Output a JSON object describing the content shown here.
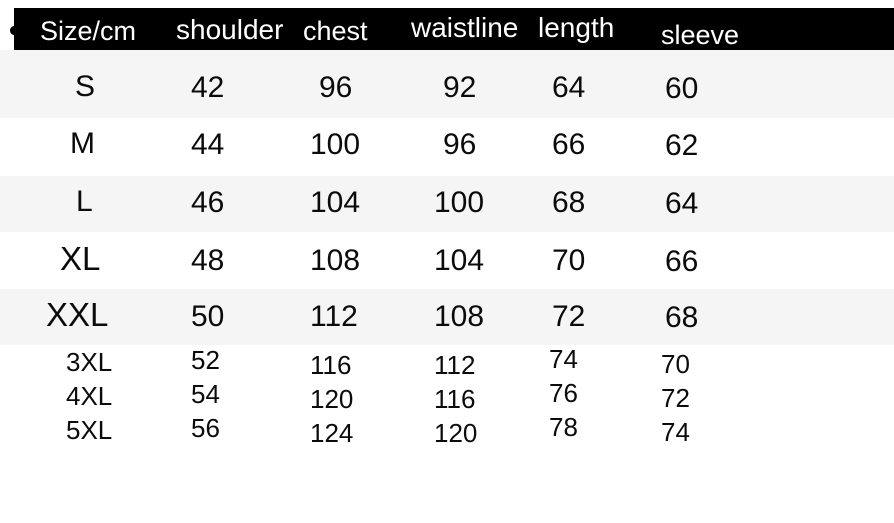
{
  "chart_data": {
    "type": "table",
    "title": "Size/cm",
    "columns": [
      "Size/cm",
      "shoulder",
      "chest",
      "waistline",
      "length",
      "sleeve"
    ],
    "rows": [
      {
        "size": "S",
        "shoulder": "42",
        "chest": "96",
        "waistline": "92",
        "length": "64",
        "sleeve": "60"
      },
      {
        "size": "M",
        "shoulder": "44",
        "chest": "100",
        "waistline": "96",
        "length": "66",
        "sleeve": "62"
      },
      {
        "size": "L",
        "shoulder": "46",
        "chest": "104",
        "waistline": "100",
        "length": "68",
        "sleeve": "64"
      },
      {
        "size": "XL",
        "shoulder": "48",
        "chest": "108",
        "waistline": "104",
        "length": "70",
        "sleeve": "66"
      },
      {
        "size": "XXL",
        "shoulder": "50",
        "chest": "112",
        "waistline": "108",
        "length": "72",
        "sleeve": "68"
      },
      {
        "size": "3XL",
        "shoulder": "52",
        "chest": "116",
        "waistline": "112",
        "length": "74",
        "sleeve": "70"
      },
      {
        "size": "4XL",
        "shoulder": "54",
        "chest": "120",
        "waistline": "116",
        "length": "76",
        "sleeve": "72"
      },
      {
        "size": "5XL",
        "shoulder": "56",
        "chest": "124",
        "waistline": "120",
        "length": "78",
        "sleeve": "74"
      }
    ],
    "xlabel": "",
    "ylabel": "",
    "legend": "none",
    "grid": false
  },
  "header": {
    "col_size": "Size/cm",
    "col_shoulder": "shoulder",
    "col_chest": "chest",
    "col_waistline": "waistline",
    "col_length": "length",
    "col_sleeve": "sleeve",
    "background_color": "#000000",
    "text_color": "#ffffff"
  },
  "colors": {
    "stripe": "#f5f5f5",
    "page": "#ffffff",
    "text": "#0b0b0b"
  },
  "rows": {
    "r0": {
      "size": "S",
      "shoulder": "42",
      "chest": "96",
      "waistline": "92",
      "length": "64",
      "sleeve": "60"
    },
    "r1": {
      "size": "M",
      "shoulder": "44",
      "chest": "100",
      "waistline": "96",
      "length": "66",
      "sleeve": "62"
    },
    "r2": {
      "size": "L",
      "shoulder": "46",
      "chest": "104",
      "waistline": "100",
      "length": "68",
      "sleeve": "64"
    },
    "r3": {
      "size": "XL",
      "shoulder": "48",
      "chest": "108",
      "waistline": "104",
      "length": "70",
      "sleeve": "66"
    },
    "r4": {
      "size": "XXL",
      "shoulder": "50",
      "chest": "112",
      "waistline": "108",
      "length": "72",
      "sleeve": "68"
    },
    "r5": {
      "size": "3XL",
      "shoulder": "52",
      "chest": "116",
      "waistline": "112",
      "length": "74",
      "sleeve": "70"
    },
    "r6": {
      "size": "4XL",
      "shoulder": "54",
      "chest": "120",
      "waistline": "116",
      "length": "76",
      "sleeve": "72"
    },
    "r7": {
      "size": "5XL",
      "shoulder": "56",
      "chest": "124",
      "waistline": "120",
      "length": "78",
      "sleeve": "74"
    }
  }
}
